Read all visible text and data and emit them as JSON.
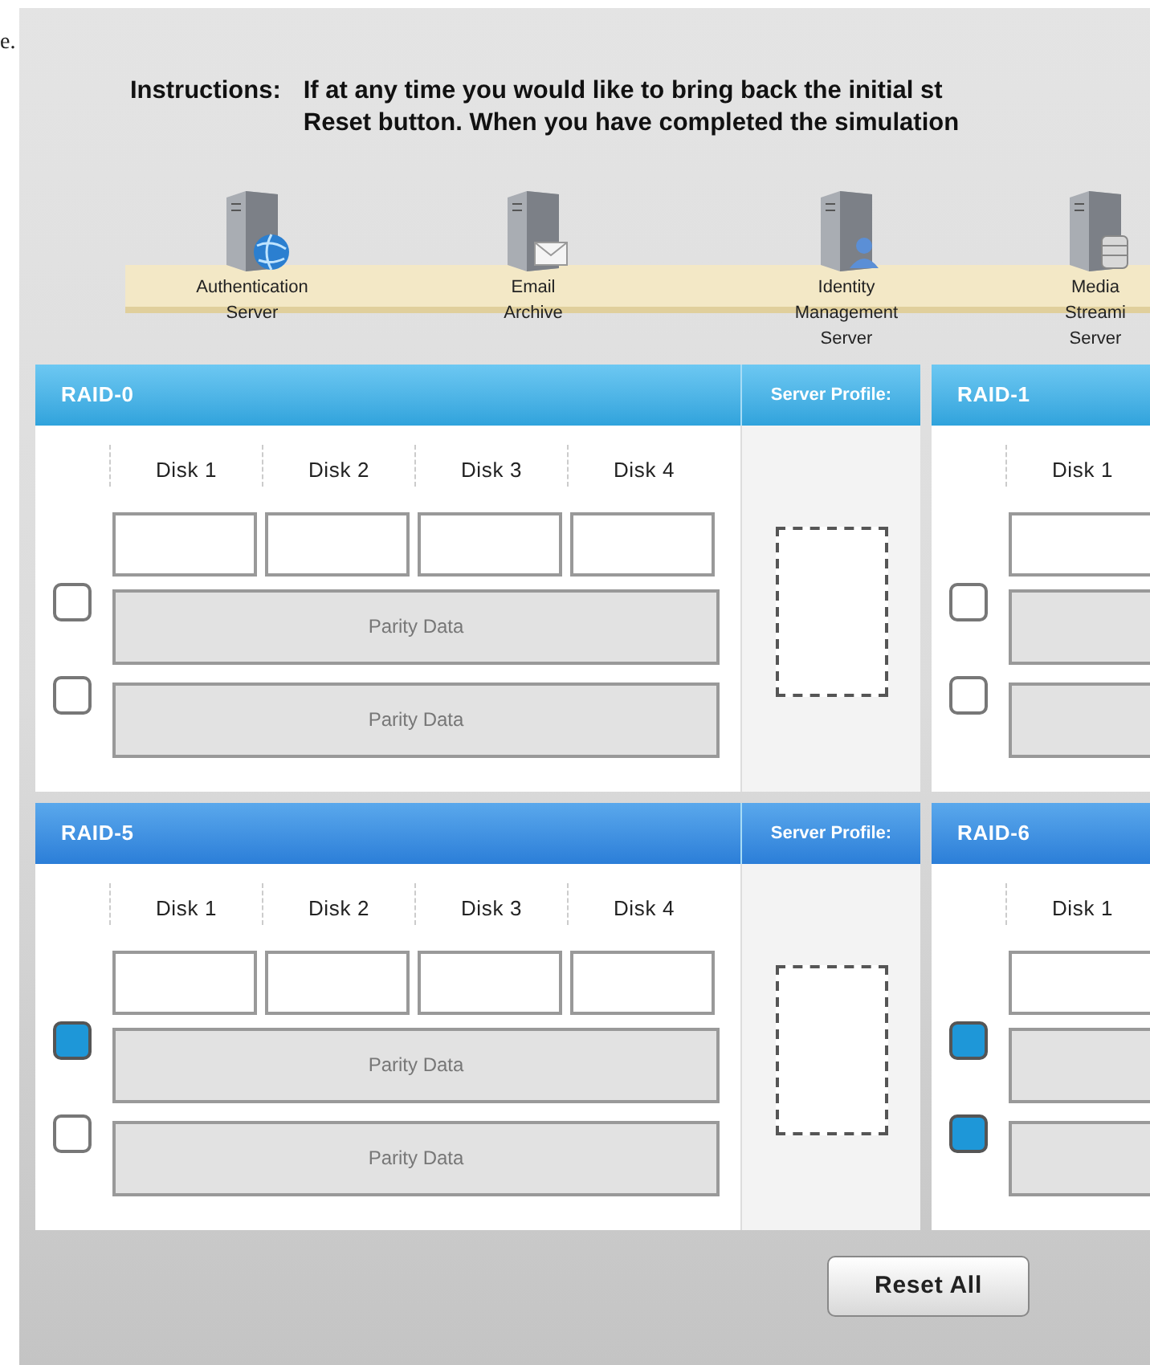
{
  "page_fragment": "e.",
  "instructions": {
    "label": "Instructions:",
    "lines": [
      "If at any time you would like to bring back the initial st",
      "Reset button. When you have completed the simulation"
    ]
  },
  "servers": [
    {
      "kind": "globe",
      "lines": [
        "Authentication",
        "Server"
      ]
    },
    {
      "kind": "mail",
      "lines": [
        "Email",
        "Archive"
      ]
    },
    {
      "kind": "user",
      "lines": [
        "Identity",
        "Management",
        "Server"
      ]
    },
    {
      "kind": "database",
      "lines": [
        "Media",
        "Streami",
        "Server"
      ]
    }
  ],
  "raid_rows": [
    {
      "panels": [
        {
          "title": "RAID-0",
          "profile_label": "Server Profile:",
          "disks": [
            "Disk 1",
            "Disk 2",
            "Disk 3",
            "Disk 4"
          ],
          "rows": [
            {
              "label": "Parity Data",
              "checked": false
            },
            {
              "label": "Parity Data",
              "checked": false
            }
          ]
        },
        {
          "title": "RAID-1",
          "disks": [
            "Disk 1"
          ],
          "rows": [
            {
              "checked": false
            },
            {
              "checked": false
            }
          ]
        }
      ]
    },
    {
      "panels": [
        {
          "title": "RAID-5",
          "profile_label": "Server Profile:",
          "disks": [
            "Disk 1",
            "Disk 2",
            "Disk 3",
            "Disk 4"
          ],
          "rows": [
            {
              "label": "Parity Data",
              "checked": true
            },
            {
              "label": "Parity Data",
              "checked": false
            }
          ]
        },
        {
          "title": "RAID-6",
          "disks": [
            "Disk 1"
          ],
          "rows": [
            {
              "checked": true
            },
            {
              "checked": true
            }
          ]
        }
      ]
    }
  ],
  "reset_button": "Reset All"
}
